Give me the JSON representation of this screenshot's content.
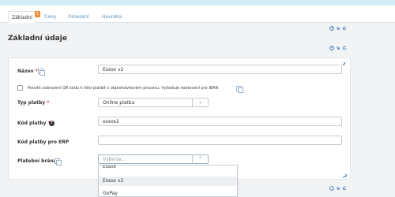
{
  "tabs": [
    {
      "label": "Základní",
      "badge": "1"
    },
    {
      "label": "Ceny"
    },
    {
      "label": "Omezení"
    },
    {
      "label": "Heureka"
    }
  ],
  "page_title": "Základní údaje",
  "form": {
    "name_label": "Název",
    "name_required": "*",
    "name_value": "Essox v2",
    "qr_label": "Povolit zobrazení QR kódu k této platbě v objednávkovém procesu. Vyžaduje nastavení pro IBAN",
    "type_label": "Typ platby",
    "type_required": "*",
    "type_value": "Online platba",
    "code_label": "Kód platby",
    "code_required": "*",
    "code_help": "?",
    "code_value": "essox2",
    "erp_label": "Kód platby pro ERP",
    "erp_value": "",
    "gateway_label": "Platební brána",
    "gateway_placeholder": "Vyberte...",
    "gateway_options": [
      "Essox",
      "Essox v2",
      "GoPay"
    ],
    "gateway_highlighted": "Essox v2"
  },
  "colors": {
    "accent_orange": "#f08c38",
    "link_blue": "#5a8fb7",
    "icon_blue": "#2f6fb0"
  }
}
